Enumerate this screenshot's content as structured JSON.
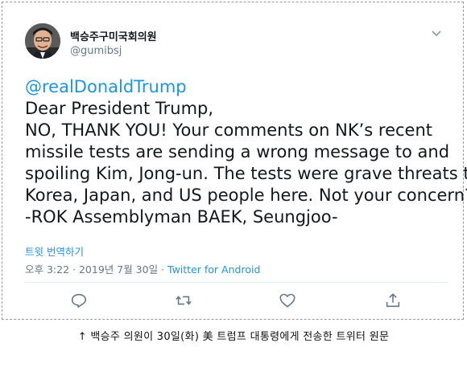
{
  "tweet": {
    "display_name": "백승주구미국회의원",
    "handle": "@gumibsj",
    "mention": "@realDonaldTrump",
    "lines": [
      "Dear President Trump,",
      "NO, THANK YOU! Your comments on NK’s recent",
      "missile tests are sending a wrong message to and",
      "spoiling Kim, Jong-un. The tests were grave threats to",
      "Korea, Japan, and US people here. Not your concern?",
      "-ROK Assemblyman BAEK, Seungjoo-"
    ],
    "translate_label": "트윗 번역하기",
    "timestamp": "오후 3:22 · 2019년 7월 30일 · ",
    "source": "Twitter for Android"
  },
  "actions": {
    "reply_icon": "reply-icon",
    "retweet_icon": "retweet-icon",
    "like_icon": "like-icon",
    "share_icon": "share-icon"
  },
  "caption": "↑ 백승주 의원이 30일(화) 美 트럼프 대통령에게 전송한 트위터 원문",
  "colors": {
    "link": "#1b95e0",
    "text": "#14171a",
    "muted": "#657786"
  }
}
